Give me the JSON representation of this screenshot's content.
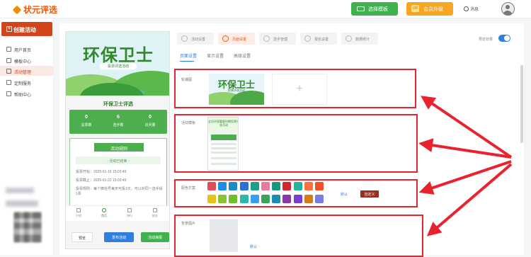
{
  "brand": {
    "name": "状元评选"
  },
  "header": {
    "template_btn": "选择模板",
    "vip_btn": "会员升级",
    "messages": "消息"
  },
  "sidebar": {
    "create_btn": "创建活动",
    "items": [
      {
        "label": "用户首页"
      },
      {
        "label": "模板中心"
      },
      {
        "label": "活动管理"
      },
      {
        "label": "定制服务"
      },
      {
        "label": "帮助中心"
      }
    ]
  },
  "preview": {
    "banner_title": "环保卫士",
    "banner_subtitle": "· 投票评选活动 ·",
    "activity_title": "环保卫士评选",
    "stats": [
      {
        "value": "0",
        "label": "总票数"
      },
      {
        "value": "6",
        "label": "选手数"
      },
      {
        "value": "0",
        "label": "访问量"
      }
    ],
    "rules_header": "活动规则",
    "rules_status": "- 活动已结束 -",
    "rules": [
      "投票开始：2025-01-16 15:03:49",
      "投票截止：2025-01-22 15:03:49",
      "投票规则：每个微信号每天可投1次，可以对同一选手投1票"
    ],
    "tabbar": [
      "介绍",
      "首页",
      "排行",
      "报名"
    ],
    "buttons": {
      "preview": "预览",
      "publish": "发布活动",
      "poster": "活动海报"
    }
  },
  "steps": [
    "活动设置",
    "页面设置",
    "选手管理",
    "报名设置",
    "数据统计"
  ],
  "toggle_label": "预览效果",
  "subtabs": [
    "页面设置",
    "显示设置",
    "高级设置"
  ],
  "sections": {
    "banner_label": "轮播图",
    "banner_img_title": "环保卫士",
    "banner_img_sub": "投票评选活动",
    "template_label": "活动模板",
    "template_thumb_title": "全员环保重要时期投票评选活动",
    "color_label": "配色方案",
    "color_default": "默认",
    "custom_btn": "自定义",
    "bg_label": "背景图片",
    "bg_default": "默认"
  },
  "colors": {
    "accent": "#e8590c",
    "primary": "#2f7fe0",
    "green": "#3fb14f",
    "orange": "#f6a623",
    "highlight": "#e8232e",
    "swatches_row1": [
      "#e14b5a",
      "#1d8fe0",
      "#1e88c8",
      "#2d6fd6",
      "#1a9e8a",
      "#e67ba0",
      "#179a7a",
      "#d0262d",
      "#26b39c",
      "#ff6f3c",
      "#f04f27"
    ],
    "swatches_row2": [
      "#e7c31a",
      "#88c52e",
      "#6fbf2a",
      "#2cb8a8",
      "#3a9df0",
      "#3aa55a",
      "#1f8bb5",
      "#8a3aa8",
      "#7a3fd0",
      "#d67a1c",
      "#7a7de0"
    ]
  }
}
